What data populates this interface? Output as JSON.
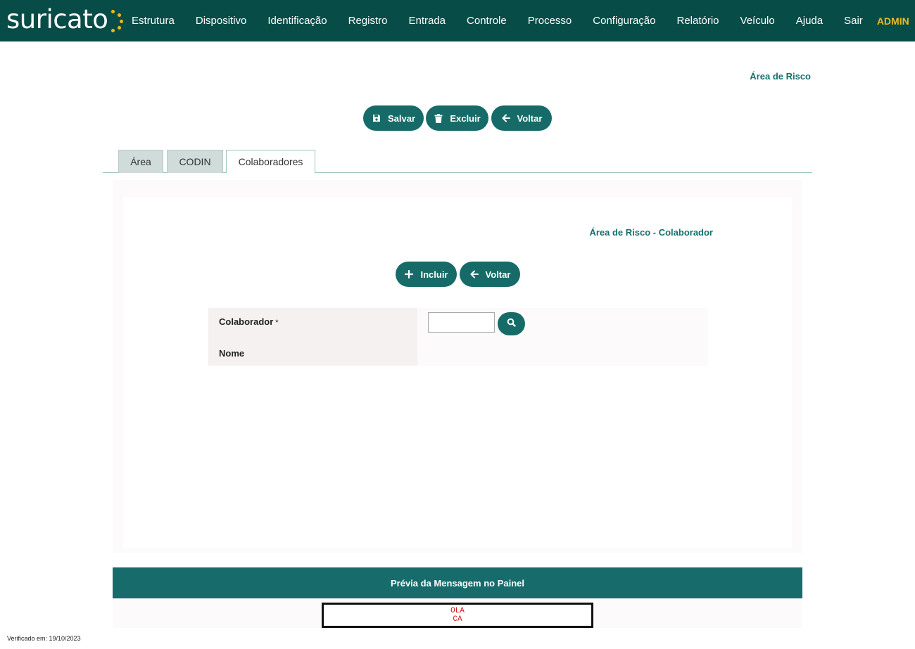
{
  "brand": {
    "logo_text": "suricato",
    "dot_color": "#f0b818"
  },
  "nav": {
    "items": [
      "Estrutura",
      "Dispositivo",
      "Identificação",
      "Registro",
      "Entrada",
      "Controle",
      "Processo",
      "Configuração",
      "Relatório",
      "Veículo",
      "Ajuda",
      "Sair"
    ],
    "user": "ADMIN"
  },
  "page": {
    "title": "Área de Risco"
  },
  "toolbar": {
    "save_label": "Salvar",
    "delete_label": "Excluir",
    "back_label": "Voltar"
  },
  "tabs": [
    {
      "label": "Área",
      "active": false
    },
    {
      "label": "CODIN",
      "active": false
    },
    {
      "label": "Colaboradores",
      "active": true
    }
  ],
  "sub": {
    "title": "Área de Risco - Colaborador",
    "include_label": "Incluir",
    "back_label": "Voltar"
  },
  "form": {
    "colaborador_label": "Colaborador",
    "required_mark": "*",
    "colaborador_value": "",
    "nome_label": "Nome"
  },
  "preview": {
    "header": "Prévia da Mensagem no Painel",
    "lines": [
      "OLA",
      "CA"
    ]
  },
  "footer": {
    "verified": "Verificado em: 19/10/2023"
  },
  "colors": {
    "header_bg": "#084c47",
    "accent": "#166b68",
    "title": "#15706c",
    "admin": "#f0b818",
    "preview_text": "#d11a1a"
  }
}
